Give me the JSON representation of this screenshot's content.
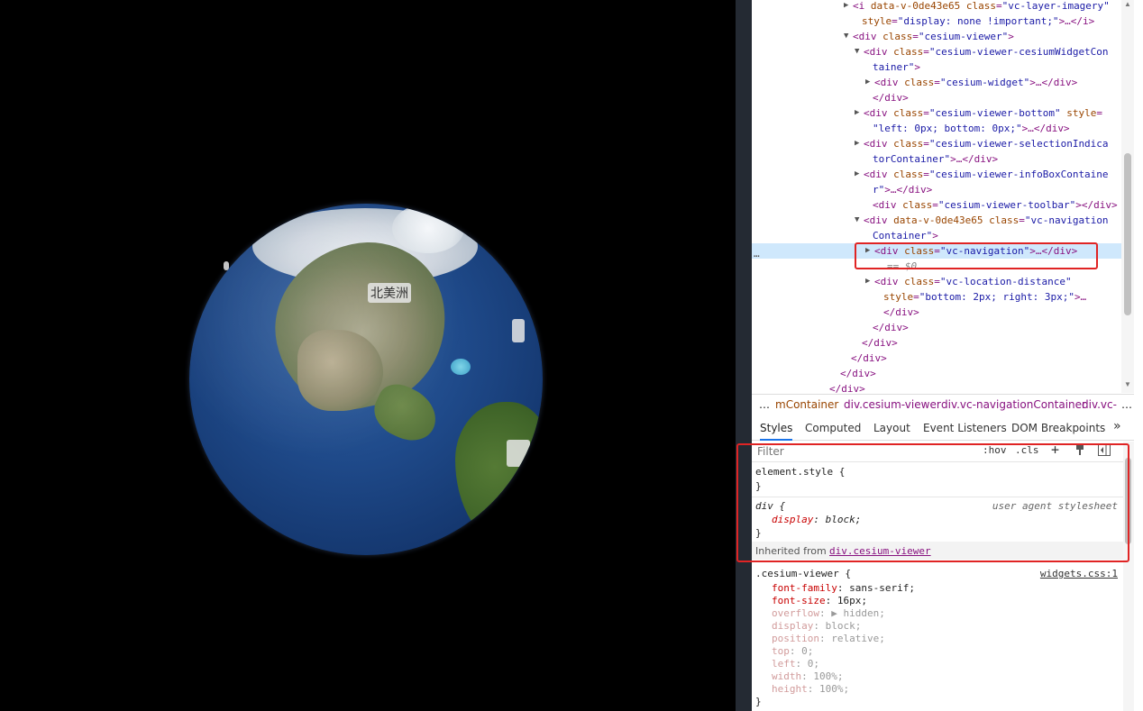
{
  "globe": {
    "label_north_america": "北美洲"
  },
  "elements_panel": {
    "lines": [
      {
        "indent": 112,
        "tri": "▶",
        "parts": [
          [
            "tag",
            "<i "
          ],
          [
            "attr",
            "data-v-0de43e65"
          ],
          [
            "tag",
            " "
          ],
          [
            "attr",
            "class"
          ],
          [
            "tag",
            "="
          ],
          [
            "val",
            "\"vc-layer-imagery\""
          ]
        ]
      },
      {
        "indent": 122,
        "tri": "",
        "parts": [
          [
            "attr",
            "style"
          ],
          [
            "tag",
            "="
          ],
          [
            "val",
            "\"display: none !important;\""
          ],
          [
            "tag",
            ">…</i>"
          ]
        ]
      },
      {
        "indent": 112,
        "tri": "▼",
        "parts": [
          [
            "tag",
            "<div "
          ],
          [
            "attr",
            "class"
          ],
          [
            "tag",
            "="
          ],
          [
            "val",
            "\"cesium-viewer\""
          ],
          [
            "tag",
            ">"
          ]
        ]
      },
      {
        "indent": 124,
        "tri": "▼",
        "parts": [
          [
            "tag",
            "<div "
          ],
          [
            "attr",
            "class"
          ],
          [
            "tag",
            "="
          ],
          [
            "val",
            "\"cesium-viewer-cesiumWidgetCon"
          ]
        ]
      },
      {
        "indent": 134,
        "tri": "",
        "parts": [
          [
            "val",
            "tainer\""
          ],
          [
            "tag",
            ">"
          ]
        ]
      },
      {
        "indent": 136,
        "tri": "▶",
        "parts": [
          [
            "tag",
            "<div "
          ],
          [
            "attr",
            "class"
          ],
          [
            "tag",
            "="
          ],
          [
            "val",
            "\"cesium-widget\""
          ],
          [
            "tag",
            ">…</div>"
          ]
        ]
      },
      {
        "indent": 134,
        "tri": "",
        "parts": [
          [
            "tag",
            "</div>"
          ]
        ]
      },
      {
        "indent": 124,
        "tri": "▶",
        "parts": [
          [
            "tag",
            "<div "
          ],
          [
            "attr",
            "class"
          ],
          [
            "tag",
            "="
          ],
          [
            "val",
            "\"cesium-viewer-bottom\""
          ],
          [
            "tag",
            " "
          ],
          [
            "attr",
            "style"
          ],
          [
            "tag",
            "="
          ]
        ]
      },
      {
        "indent": 134,
        "tri": "",
        "parts": [
          [
            "val",
            "\"left: 0px; bottom: 0px;\""
          ],
          [
            "tag",
            ">…</div>"
          ]
        ]
      },
      {
        "indent": 124,
        "tri": "▶",
        "parts": [
          [
            "tag",
            "<div "
          ],
          [
            "attr",
            "class"
          ],
          [
            "tag",
            "="
          ],
          [
            "val",
            "\"cesium-viewer-selectionIndica"
          ]
        ]
      },
      {
        "indent": 134,
        "tri": "",
        "parts": [
          [
            "val",
            "torContainer\""
          ],
          [
            "tag",
            ">…</div>"
          ]
        ]
      },
      {
        "indent": 124,
        "tri": "▶",
        "parts": [
          [
            "tag",
            "<div "
          ],
          [
            "attr",
            "class"
          ],
          [
            "tag",
            "="
          ],
          [
            "val",
            "\"cesium-viewer-infoBoxContaine"
          ]
        ]
      },
      {
        "indent": 134,
        "tri": "",
        "parts": [
          [
            "val",
            "r\""
          ],
          [
            "tag",
            ">…</div>"
          ]
        ]
      },
      {
        "indent": 134,
        "tri": "",
        "parts": [
          [
            "tag",
            "<div "
          ],
          [
            "attr",
            "class"
          ],
          [
            "tag",
            "="
          ],
          [
            "val",
            "\"cesium-viewer-toolbar\""
          ],
          [
            "tag",
            "></div>"
          ]
        ]
      },
      {
        "indent": 124,
        "tri": "▼",
        "parts": [
          [
            "tag",
            "<div "
          ],
          [
            "attr",
            "data-v-0de43e65"
          ],
          [
            "tag",
            " "
          ],
          [
            "attr",
            "class"
          ],
          [
            "tag",
            "="
          ],
          [
            "val",
            "\"vc-navigation"
          ]
        ]
      },
      {
        "indent": 134,
        "tri": "",
        "parts": [
          [
            "val",
            "Container\""
          ],
          [
            "tag",
            ">"
          ]
        ]
      },
      {
        "indent": 136,
        "tri": "▶",
        "selected": true,
        "parts": [
          [
            "tag",
            "<div "
          ],
          [
            "attr",
            "class"
          ],
          [
            "tag",
            "="
          ],
          [
            "val",
            "\"vc-navigation\""
          ],
          [
            "tag",
            ">…</div>"
          ]
        ]
      },
      {
        "indent": 150,
        "tri": "",
        "parts": [
          [
            "txt",
            "== $0"
          ]
        ]
      },
      {
        "indent": 136,
        "tri": "▶",
        "parts": [
          [
            "tag",
            "<div "
          ],
          [
            "attr",
            "class"
          ],
          [
            "tag",
            "="
          ],
          [
            "val",
            "\"vc-location-distance\""
          ]
        ]
      },
      {
        "indent": 146,
        "tri": "",
        "parts": [
          [
            "attr",
            "style"
          ],
          [
            "tag",
            "="
          ],
          [
            "val",
            "\"bottom: 2px; right: 3px;\""
          ],
          [
            "tag",
            ">…"
          ]
        ]
      },
      {
        "indent": 146,
        "tri": "",
        "parts": [
          [
            "tag",
            "</div>"
          ]
        ]
      },
      {
        "indent": 134,
        "tri": "",
        "parts": [
          [
            "tag",
            "</div>"
          ]
        ]
      },
      {
        "indent": 122,
        "tri": "",
        "parts": [
          [
            "tag",
            "</div>"
          ]
        ]
      },
      {
        "indent": 110,
        "tri": "",
        "parts": [
          [
            "tag",
            "</div>"
          ]
        ]
      },
      {
        "indent": 98,
        "tri": "",
        "parts": [
          [
            "tag",
            "</div>"
          ]
        ]
      },
      {
        "indent": 86,
        "tri": "",
        "parts": [
          [
            "tag",
            "</div>"
          ]
        ]
      }
    ],
    "dots": "…"
  },
  "breadcrumbs": {
    "more_left": "…",
    "items": [
      "mContainer",
      "div.cesium-viewer",
      "div.vc-navigationContainer",
      "div.vc-"
    ],
    "more_right": "…"
  },
  "tabs": {
    "items": [
      "Styles",
      "Computed",
      "Layout",
      "Event Listeners",
      "DOM Breakpoints"
    ],
    "overflow": "»"
  },
  "filter": {
    "placeholder": "Filter",
    "hov": ":hov",
    "cls": ".cls",
    "add": "+",
    "paint_icon": "paintbrush-icon",
    "toggle_icon": "sidebar-toggle-icon"
  },
  "styles": {
    "element_style": {
      "selector": "element.style {",
      "close": "}"
    },
    "ua_rule": {
      "selector": "div {",
      "source": "user agent stylesheet",
      "prop": "display",
      "value": "block;",
      "close": "}"
    },
    "inherited": {
      "label": "Inherited from",
      "link": "div.cesium-viewer"
    },
    "cesium_rule": {
      "selector": ".cesium-viewer {",
      "source": "widgets.css:1",
      "props": [
        {
          "name": "font-family",
          "value": "sans-serif;",
          "dim": false
        },
        {
          "name": "font-size",
          "value": "16px;",
          "dim": false
        },
        {
          "name": "overflow",
          "value": "hidden;",
          "dim": true,
          "arrow": "▶"
        },
        {
          "name": "display",
          "value": "block;",
          "dim": true
        },
        {
          "name": "position",
          "value": "relative;",
          "dim": true
        },
        {
          "name": "top",
          "value": "0;",
          "dim": true
        },
        {
          "name": "left",
          "value": "0;",
          "dim": true
        },
        {
          "name": "width",
          "value": "100%;",
          "dim": true
        },
        {
          "name": "height",
          "value": "100%;",
          "dim": true
        }
      ],
      "close": "}"
    }
  },
  "colors": {
    "highlight": "#e02424",
    "tab_active": "#1a73e8",
    "selected_row": "#cfe8fc"
  }
}
